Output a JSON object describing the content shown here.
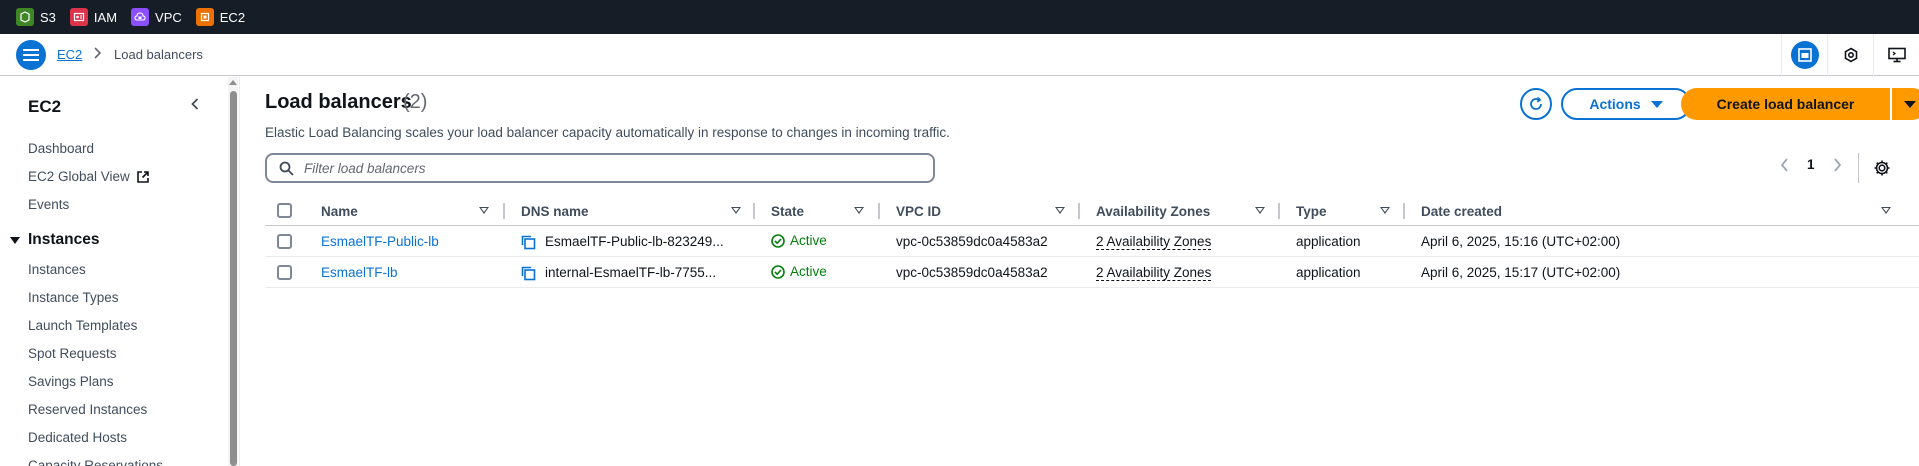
{
  "topbar": {
    "services": [
      {
        "label": "S3",
        "color": "#3f8624"
      },
      {
        "label": "IAM",
        "color": "#dd344c"
      },
      {
        "label": "VPC",
        "color": "#8c4fff"
      },
      {
        "label": "EC2",
        "color": "#ed7100"
      }
    ]
  },
  "breadcrumb": {
    "parent": "EC2",
    "current": "Load balancers"
  },
  "sidenav": {
    "title": "EC2",
    "items_top": [
      "Dashboard",
      "EC2 Global View",
      "Events"
    ],
    "section": "Instances",
    "items_section": [
      "Instances",
      "Instance Types",
      "Launch Templates",
      "Spot Requests",
      "Savings Plans",
      "Reserved Instances",
      "Dedicated Hosts",
      "Capacity Reservations"
    ]
  },
  "header": {
    "title": "Load balancers",
    "count": "(2)",
    "description": "Elastic Load Balancing scales your load balancer capacity automatically in response to changes in incoming traffic.",
    "actions_label": "Actions",
    "create_label": "Create load balancer"
  },
  "search": {
    "placeholder": "Filter load balancers",
    "value": ""
  },
  "pagination": {
    "page": "1"
  },
  "table": {
    "columns": [
      "Name",
      "DNS name",
      "State",
      "VPC ID",
      "Availability Zones",
      "Type",
      "Date created"
    ],
    "rows": [
      {
        "name": "EsmaelTF-Public-lb",
        "dns": "EsmaelTF-Public-lb-823249...",
        "state": "Active",
        "vpc": "vpc-0c53859dc0a4583a2",
        "azs": "2 Availability Zones",
        "type": "application",
        "created": "April 6, 2025, 15:16 (UTC+02:00)"
      },
      {
        "name": "EsmaelTF-lb",
        "dns": "internal-EsmaelTF-lb-7755...",
        "state": "Active",
        "vpc": "vpc-0c53859dc0a4583a2",
        "azs": "2 Availability Zones",
        "type": "application",
        "created": "April 6, 2025, 15:17 (UTC+02:00)"
      }
    ]
  },
  "colors": {
    "primary": "#0972d3",
    "orange": "#ff9900",
    "success": "#037f0c",
    "topbar": "#161d26"
  }
}
